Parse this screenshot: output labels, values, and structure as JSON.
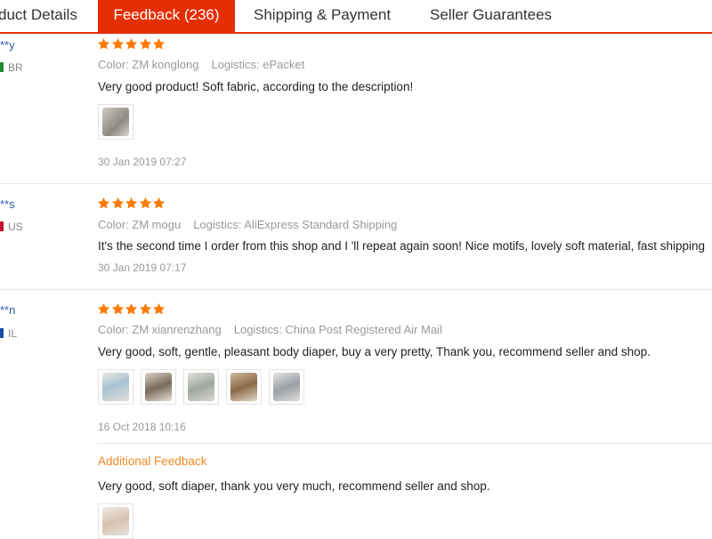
{
  "tabs": [
    {
      "label": "duct Details",
      "active": false
    },
    {
      "label": "Feedback (236)",
      "active": true
    },
    {
      "label": "Shipping & Payment",
      "active": false
    },
    {
      "label": "Seller Guarantees",
      "active": false
    }
  ],
  "colors": {
    "accent": "#e62e04",
    "star": "#ff7a00",
    "link": "#2a5db0",
    "additional": "#f08a24"
  },
  "reviews": [
    {
      "user": "**y",
      "country": "BR",
      "rating": 5,
      "color": "Color: ZM konglong",
      "logistics": "Logistics: ePacket",
      "text": "Very good product! Soft fabric, according to the description!",
      "date": "30 Jan 2019 07:27"
    },
    {
      "user": "**s",
      "country": "US",
      "rating": 5,
      "color": "Color: ZM mogu",
      "logistics": "Logistics: AliExpress Standard Shipping",
      "text": "It's the second time I order from this shop and I 'll repeat again soon! Nice motifs, lovely soft material, fast shipping",
      "date": "30 Jan 2019 07:17"
    },
    {
      "user": "**n",
      "country": "IL",
      "rating": 5,
      "color": "Color: ZM xianrenzhang",
      "logistics": "Logistics: China Post Registered Air Mail",
      "text": "Very good, soft, gentle, pleasant body diaper, buy a very pretty, Thank you, recommend seller and shop.",
      "date": "16 Oct 2018 10:16",
      "additional_label": "Additional Feedback",
      "additional_text": "Very good, soft diaper, thank you very much, recommend seller and shop."
    }
  ]
}
